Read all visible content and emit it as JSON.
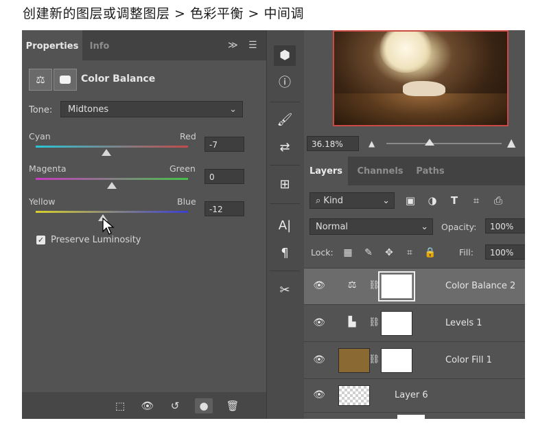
{
  "caption": "创建新的图层或调整图层 > 色彩平衡 > 中间调",
  "properties": {
    "tab_properties": "Properties",
    "tab_info": "Info",
    "menu_glyph": "≫",
    "adjustment_title": "Color Balance",
    "tone_label": "Tone:",
    "tone_value": "Midtones",
    "sliders": [
      {
        "left": "Cyan",
        "right": "Red",
        "value": "-7",
        "level": -7
      },
      {
        "left": "Magenta",
        "right": "Green",
        "value": "0",
        "level": 0
      },
      {
        "left": "Yellow",
        "right": "Blue",
        "value": "-12",
        "level": -12
      }
    ],
    "preserve_label": "Preserve Luminosity",
    "preserve_checked": true
  },
  "canvas": {
    "zoom": "36.18%"
  },
  "layers_panel": {
    "tabs": [
      "Layers",
      "Channels",
      "Paths"
    ],
    "filter_kind": "Kind",
    "blend_mode": "Normal",
    "opacity_label": "Opacity:",
    "opacity_value": "100%",
    "lock_label": "Lock:",
    "fill_label": "Fill:",
    "fill_value": "100%",
    "layers": [
      {
        "name": "Color Balance 2",
        "type": "adjustment",
        "icon": "scales-icon",
        "selected": true
      },
      {
        "name": "Levels 1",
        "type": "adjustment",
        "icon": "histogram-icon",
        "selected": false
      },
      {
        "name": "Color Fill 1",
        "type": "fill",
        "color": "#8a6a32",
        "selected": false
      },
      {
        "name": "Layer 6",
        "type": "pixel",
        "selected": false
      }
    ]
  },
  "colors": {
    "panel_bg": "#535353",
    "tab_bg": "#424242",
    "canvas_border": "#cc4a46"
  }
}
